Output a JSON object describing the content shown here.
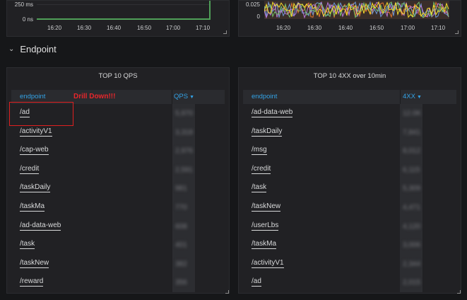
{
  "top_left": {
    "y_labels": [
      "250 ms",
      "0 ns"
    ],
    "x_labels": [
      "16:20",
      "16:30",
      "16:40",
      "16:50",
      "17:00",
      "17:10"
    ]
  },
  "top_right": {
    "y_labels": [
      "0.025",
      "0"
    ],
    "x_labels": [
      "16:20",
      "16:30",
      "16:40",
      "16:50",
      "17:00",
      "17:10"
    ]
  },
  "row_section": {
    "title": "Endpoint"
  },
  "left_panel": {
    "title": "TOP 10 QPS",
    "col_endpoint": "endpoint",
    "col_value": "QPS",
    "annotation": "Drill Down!!!",
    "rows": [
      {
        "endpoint": "/ad",
        "value": "5,970"
      },
      {
        "endpoint": "/activityV1",
        "value": "3,318"
      },
      {
        "endpoint": "/cap-web",
        "value": "2,976"
      },
      {
        "endpoint": "/credit",
        "value": "2,591"
      },
      {
        "endpoint": "/taskDaily",
        "value": "981"
      },
      {
        "endpoint": "/taskMa",
        "value": "770"
      },
      {
        "endpoint": "/ad-data-web",
        "value": "608"
      },
      {
        "endpoint": "/task",
        "value": "401"
      },
      {
        "endpoint": "/taskNew",
        "value": "382"
      },
      {
        "endpoint": "/reward",
        "value": "356"
      }
    ]
  },
  "right_panel": {
    "title": "TOP 10 4XX over 10min",
    "col_endpoint": "endpoint",
    "col_value": "4XX",
    "rows": [
      {
        "endpoint": "/ad-data-web",
        "value": "12.0K"
      },
      {
        "endpoint": "/taskDaily",
        "value": "7,841"
      },
      {
        "endpoint": "/msg",
        "value": "8,012"
      },
      {
        "endpoint": "/credit",
        "value": "6,115"
      },
      {
        "endpoint": "/task",
        "value": "5,309"
      },
      {
        "endpoint": "/taskNew",
        "value": "4,471"
      },
      {
        "endpoint": "/userLbs",
        "value": "4,120"
      },
      {
        "endpoint": "/taskMa",
        "value": "3,006"
      },
      {
        "endpoint": "/activityV1",
        "value": "2,344"
      },
      {
        "endpoint": "/ad",
        "value": "2,015"
      }
    ]
  },
  "colors": {
    "background": "#161719",
    "panel": "#212124",
    "header_blue": "#33a2e5",
    "annotation_red": "#e8262b",
    "series_green": "#4f9f58"
  }
}
